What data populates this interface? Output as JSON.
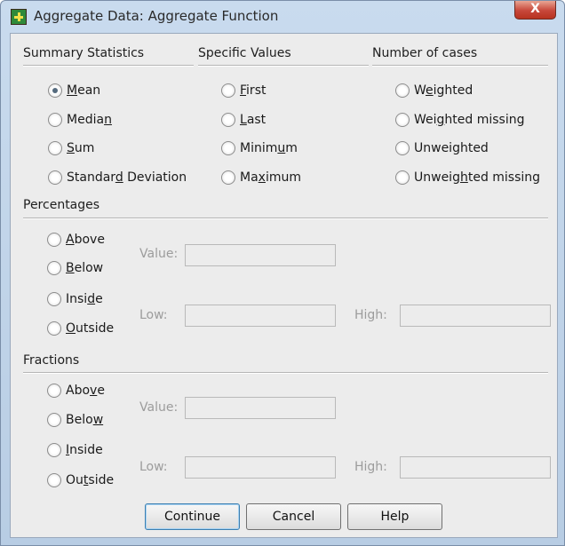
{
  "window": {
    "title": "Aggregate Data: Aggregate Function",
    "close_label": "X",
    "icon": "spss-data-grid-icon"
  },
  "summary_statistics": {
    "label": "Summary Statistics",
    "options": [
      {
        "pre": "",
        "key": "M",
        "post": "ean",
        "checked": true
      },
      {
        "pre": "Media",
        "key": "n",
        "post": "",
        "checked": false
      },
      {
        "pre": "",
        "key": "S",
        "post": "um",
        "checked": false
      },
      {
        "pre": "Standar",
        "key": "d",
        "post": " Deviation",
        "checked": false
      }
    ]
  },
  "specific_values": {
    "label": "Specific Values",
    "options": [
      {
        "pre": "",
        "key": "F",
        "post": "irst",
        "checked": false
      },
      {
        "pre": "",
        "key": "L",
        "post": "ast",
        "checked": false
      },
      {
        "pre": "Minim",
        "key": "u",
        "post": "m",
        "checked": false
      },
      {
        "pre": "Ma",
        "key": "x",
        "post": "imum",
        "checked": false
      }
    ]
  },
  "number_of_cases": {
    "label": "Number of cases",
    "options": [
      {
        "pre": "W",
        "key": "e",
        "post": "ighted",
        "checked": false
      },
      {
        "pre": "Wei",
        "key": "g",
        "post": "hted missing",
        "checked": false
      },
      {
        "pre": "Unweighted",
        "key": "",
        "post": "",
        "checked": false
      },
      {
        "pre": "Unweig",
        "key": "h",
        "post": "ted missing",
        "checked": false
      }
    ]
  },
  "percentages": {
    "label": "Percentages",
    "options": [
      {
        "pre": "",
        "key": "A",
        "post": "bove",
        "checked": false
      },
      {
        "pre": "",
        "key": "B",
        "post": "elow",
        "checked": false
      },
      {
        "pre": "Insi",
        "key": "d",
        "post": "e",
        "checked": false
      },
      {
        "pre": "",
        "key": "O",
        "post": "utside",
        "checked": false
      }
    ],
    "value_label": "Value:",
    "low_label": "Low:",
    "high_label": "High:",
    "value": "",
    "low": "",
    "high": ""
  },
  "fractions": {
    "label": "Fractions",
    "options": [
      {
        "pre": "Abo",
        "key": "v",
        "post": "e",
        "checked": false
      },
      {
        "pre": "Belo",
        "key": "w",
        "post": "",
        "checked": false
      },
      {
        "pre": "",
        "key": "I",
        "post": "nside",
        "checked": false
      },
      {
        "pre": "Ou",
        "key": "t",
        "post": "side",
        "checked": false
      }
    ],
    "value_label": "Value:",
    "low_label": "Low:",
    "high_label": "High:",
    "value": "",
    "low": "",
    "high": ""
  },
  "buttons": {
    "continue": "Continue",
    "cancel": "Cancel",
    "help": "Help"
  }
}
